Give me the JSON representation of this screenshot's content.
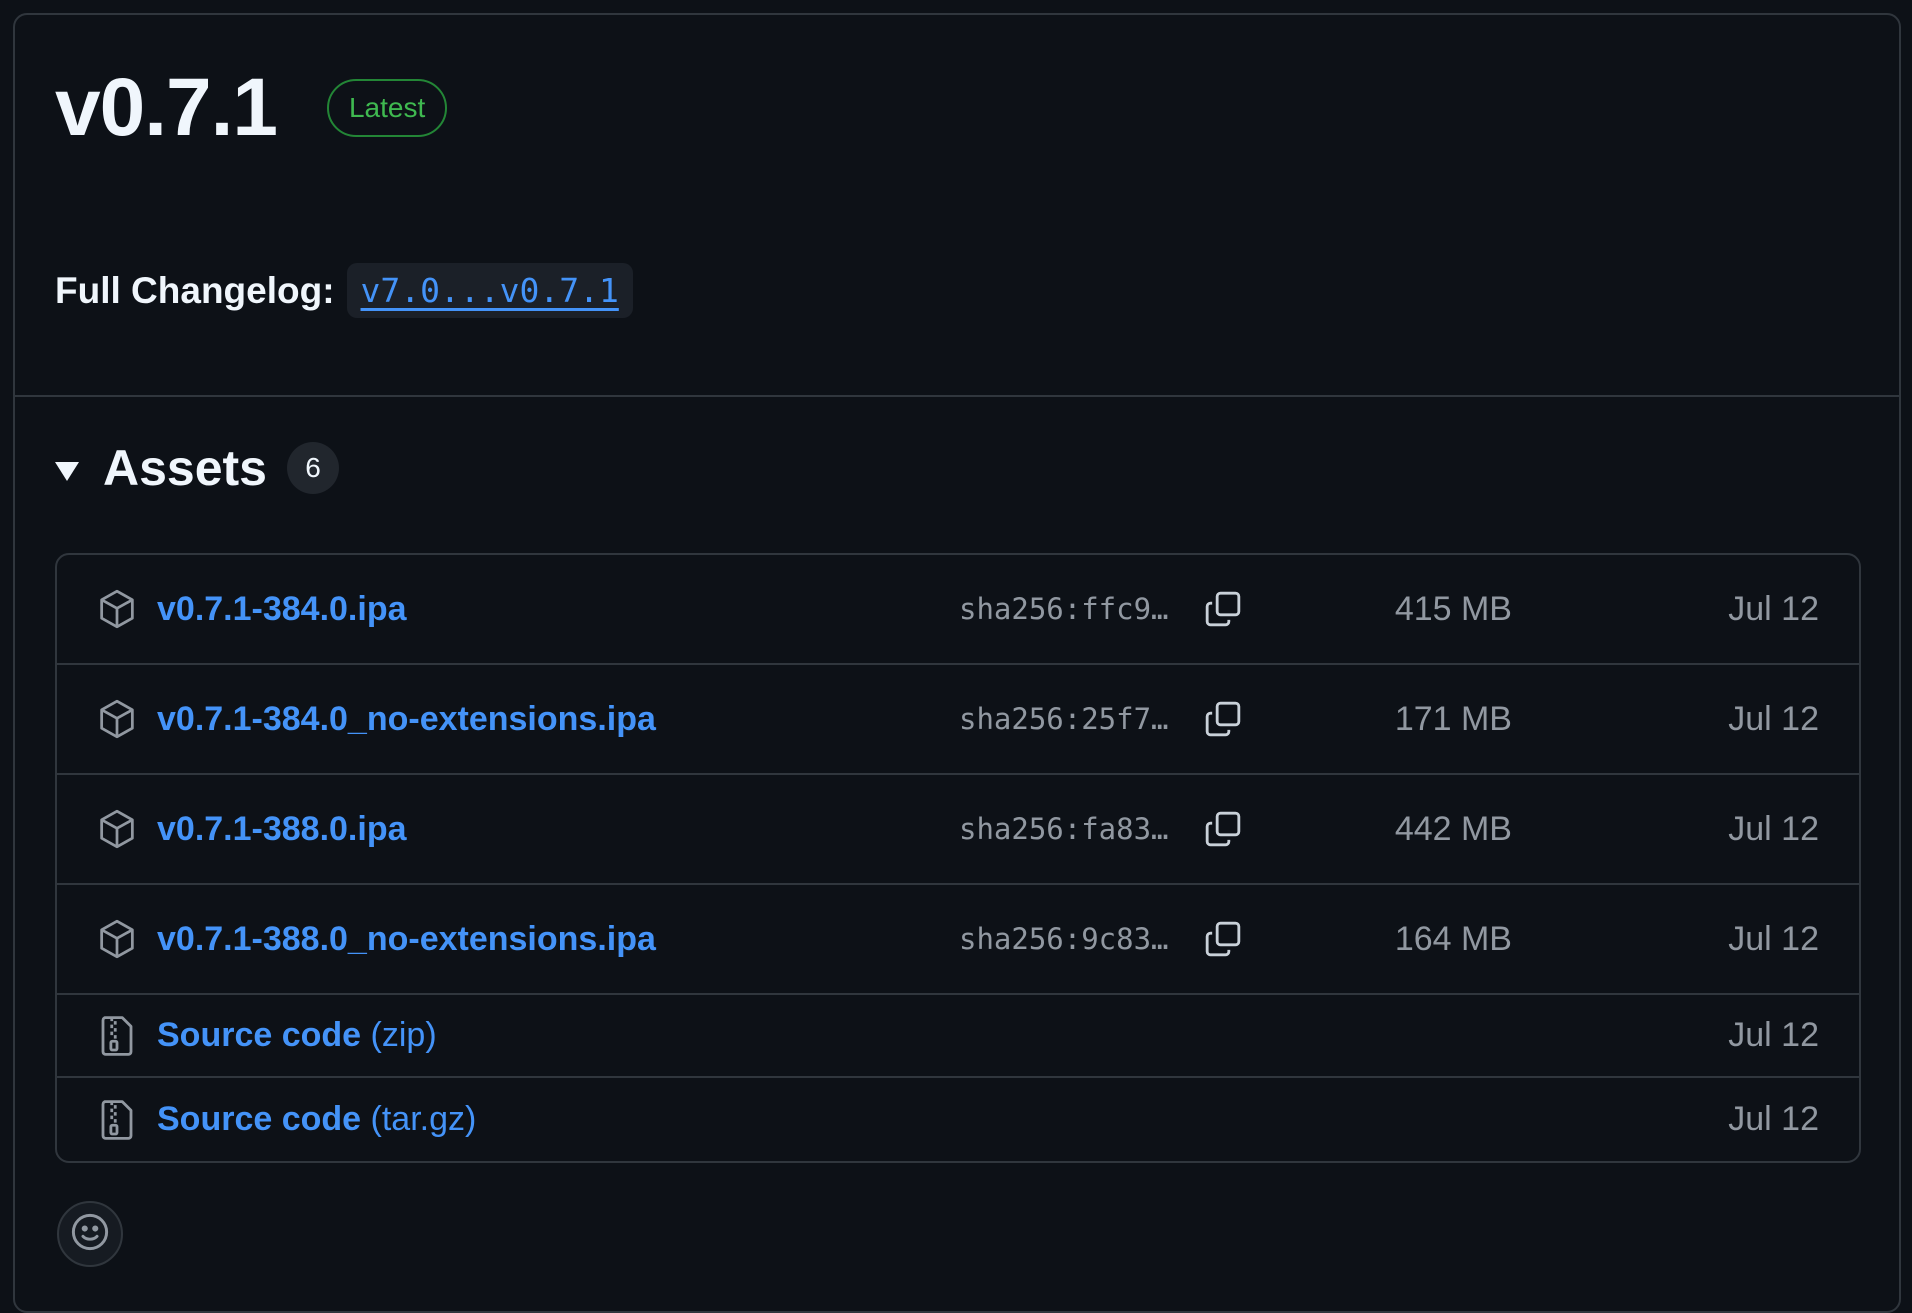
{
  "release": {
    "version": "v0.7.1",
    "badge": "Latest",
    "changelog_label": "Full Changelog:",
    "changelog_link": "v7.0...v0.7.1"
  },
  "assets": {
    "title": "Assets",
    "count": "6",
    "items": [
      {
        "icon": "package-icon",
        "name": "v0.7.1-384.0.ipa",
        "sha": "sha256:ffc9…",
        "size": "415 MB",
        "date": "Jul 12"
      },
      {
        "icon": "package-icon",
        "name": "v0.7.1-384.0_no-extensions.ipa",
        "sha": "sha256:25f7…",
        "size": "171 MB",
        "date": "Jul 12"
      },
      {
        "icon": "package-icon",
        "name": "v0.7.1-388.0.ipa",
        "sha": "sha256:fa83…",
        "size": "442 MB",
        "date": "Jul 12"
      },
      {
        "icon": "package-icon",
        "name": "v0.7.1-388.0_no-extensions.ipa",
        "sha": "sha256:9c83…",
        "size": "164 MB",
        "date": "Jul 12"
      }
    ],
    "sources": [
      {
        "icon": "file-zip-icon",
        "name": "Source code",
        "suffix": "(zip)",
        "date": "Jul 12"
      },
      {
        "icon": "file-zip-icon",
        "name": "Source code",
        "suffix": "(tar.gz)",
        "date": "Jul 12"
      }
    ]
  },
  "colors": {
    "background": "#0d1117",
    "border": "#30363d",
    "link": "#4493f8",
    "latest_green": "#3fb950",
    "muted": "#9198a1"
  },
  "reaction": {
    "icon": "smiley-icon"
  }
}
